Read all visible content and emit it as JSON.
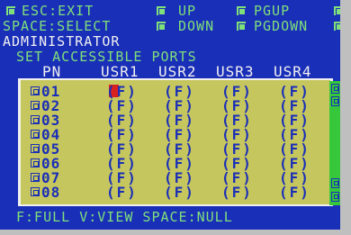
{
  "header": {
    "esc_label": "ESC:EXIT",
    "up_label": "UP",
    "pgup_label": "PGUP",
    "space_label": "SPACE:SELECT",
    "down_label": "DOWN",
    "pgdown_label": "PGDOWN",
    "user": "ADMINISTRATOR",
    "title": "SET ACCESSIBLE PORTS"
  },
  "table": {
    "columns": [
      "PN",
      "USR1",
      "USR2",
      "USR3",
      "USR4"
    ],
    "rows": [
      {
        "pn": "01",
        "cells": [
          "(F)",
          "(F)",
          "(F)",
          "(F)"
        ]
      },
      {
        "pn": "02",
        "cells": [
          "(F)",
          "(F)",
          "(F)",
          "(F)"
        ]
      },
      {
        "pn": "03",
        "cells": [
          "(F)",
          "(F)",
          "(F)",
          "(F)"
        ]
      },
      {
        "pn": "04",
        "cells": [
          "(F)",
          "(F)",
          "(F)",
          "(F)"
        ]
      },
      {
        "pn": "05",
        "cells": [
          "(F)",
          "(F)",
          "(F)",
          "(F)"
        ]
      },
      {
        "pn": "06",
        "cells": [
          "(F)",
          "(F)",
          "(F)",
          "(F)"
        ]
      },
      {
        "pn": "07",
        "cells": [
          "(F)",
          "(F)",
          "(F)",
          "(F)"
        ]
      },
      {
        "pn": "08",
        "cells": [
          "(F)",
          "(F)",
          "(F)",
          "(F)"
        ]
      }
    ]
  },
  "footer": {
    "hint": "F:FULL V:VIEW SPACE:NULL"
  },
  "colors": {
    "background": "#1a2fb8",
    "panel": "#c6c65e",
    "accent_green": "#7fe07a",
    "scrollbar": "#36c83a",
    "cursor": "#d82020"
  }
}
